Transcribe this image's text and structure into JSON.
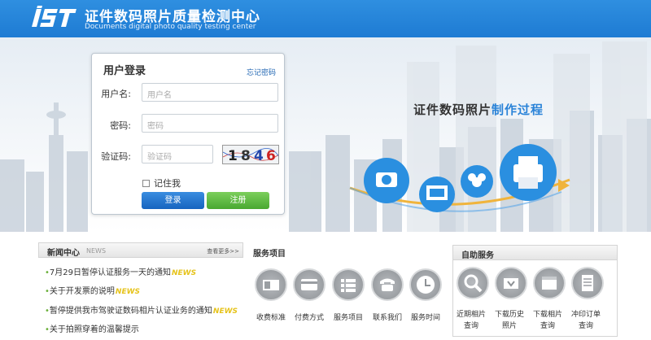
{
  "header": {
    "title": "证件数码照片质量检测中心",
    "subtitle": "Documents digital photo quality testing center"
  },
  "login": {
    "title": "用户登录",
    "forgot": "忘记密码",
    "username_label": "用户名:",
    "username_placeholder": "用户名",
    "password_label": "密码:",
    "password_placeholder": "密码",
    "captcha_label": "验证码:",
    "captcha_placeholder": "验证码",
    "captcha_text": [
      "1",
      "8",
      "4",
      "6"
    ],
    "remember": "记住我",
    "login_button": "登录",
    "register_button": "注册"
  },
  "banner": {
    "process_a": "证件数码照片",
    "process_b": "制作过程"
  },
  "news": {
    "title": "新闻中心",
    "title_en": "NEWS",
    "more": "查看更多>>",
    "items": [
      {
        "text": "7月29日暂停认证服务一天的通知",
        "tag": "NEWS"
      },
      {
        "text": "关于开发票的说明",
        "tag": "NEWS"
      },
      {
        "text": "暂停提供我市驾驶证数码相片认证业务的通知",
        "tag": "NEWS"
      },
      {
        "text": "关于拍照穿着的温馨提示",
        "tag": ""
      }
    ]
  },
  "services": {
    "title": "服务项目",
    "items": [
      {
        "label": "收费标准",
        "icon": "price-standard-icon"
      },
      {
        "label": "付费方式",
        "icon": "payment-method-icon"
      },
      {
        "label": "服务项目",
        "icon": "service-list-icon"
      },
      {
        "label": "联系我们",
        "icon": "phone-icon"
      },
      {
        "label": "服务时间",
        "icon": "clock-icon"
      }
    ]
  },
  "self_service": {
    "title": "自助服务",
    "items": [
      {
        "label1": "近期相片",
        "label2": "查询",
        "icon": "search-icon"
      },
      {
        "label1": "下载历史",
        "label2": "照片",
        "icon": "download-history-icon"
      },
      {
        "label1": "下载相片",
        "label2": "查询",
        "icon": "calendar-icon"
      },
      {
        "label1": "冲印订单",
        "label2": "查询",
        "icon": "print-order-icon"
      }
    ]
  }
}
